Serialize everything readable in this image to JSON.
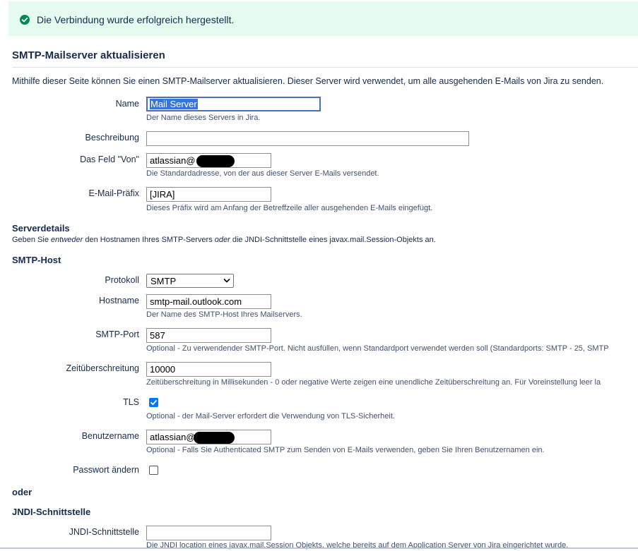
{
  "flag": {
    "message": "Die Verbindung wurde erfolgreich hergestellt.",
    "icon": "check-circle-icon",
    "color": "#00875a",
    "background": "#e3fcef"
  },
  "page": {
    "title": "SMTP-Mailserver aktualisieren",
    "intro": "Mithilfe dieser Seite können Sie einen SMTP-Mailserver aktualisieren. Dieser Server wird verwendet, um alle ausgehenden E-Mails von Jira zu senden."
  },
  "fields": {
    "name": {
      "label": "Name",
      "value": "Mail Server",
      "desc": "Der Name dieses Servers in Jira."
    },
    "description": {
      "label": "Beschreibung",
      "value": ""
    },
    "from": {
      "label": "Das Feld \"Von\"",
      "value": "atlassian@",
      "desc": "Die Standardadresse, von der aus dieser Server E-Mails versendet."
    },
    "prefix": {
      "label": "E-Mail-Präfix",
      "value": "[JIRA]",
      "desc": "Dieses Präfix wird am Anfang der Betreffzeile aller ausgehenden E-Mails eingefügt."
    }
  },
  "server_details": {
    "title": "Serverdetails",
    "desc_pre": "Geben Sie ",
    "desc_em1": "entweder",
    "desc_mid": " den Hostnamen Ihres SMTP-Servers ",
    "desc_em2": "oder",
    "desc_post": " die JNDI-Schnittstelle eines javax.mail.Session-Objekts an."
  },
  "smtp_host": {
    "title": "SMTP-Host",
    "protocol": {
      "label": "Protokoll",
      "value": "SMTP"
    },
    "hostname": {
      "label": "Hostname",
      "value": "smtp-mail.outlook.com",
      "desc": "Der Name des SMTP-Host Ihres Mailservers."
    },
    "port": {
      "label": "SMTP-Port",
      "value": "587",
      "desc": "Optional - Zu verwendender SMTP-Port. Nicht ausfüllen, wenn Standardport verwendet werden soll (Standardports: SMTP - 25, SMTP"
    },
    "timeout": {
      "label": "Zeitüberschreitung",
      "value": "10000",
      "desc": "Zeitüberschreitung in Millisekunden - 0 oder negative Werte zeigen eine unendliche Zeitüberschreitung an. Für Voreinstellung leer la"
    },
    "tls": {
      "label": "TLS",
      "checked": true,
      "desc": "Optional - der Mail-Server erfordert die Verwendung von TLS-Sicherheit."
    },
    "username": {
      "label": "Benutzername",
      "value": "atlassian@",
      "desc": "Optional - Falls Sie Authenticated SMTP zum Senden von E-Mails verwenden, geben Sie Ihren Benutzernamen ein."
    },
    "change_password": {
      "label": "Passwort ändern",
      "checked": false
    }
  },
  "or_label": "oder",
  "jndi": {
    "title": "JNDI-Schnittstelle",
    "label": "JNDI-Schnittstelle",
    "value": "",
    "desc": "Die JNDI location eines javax.mail.Session Objekts, welche bereits auf dem Application Server von Jira eingerichtet wurde."
  }
}
